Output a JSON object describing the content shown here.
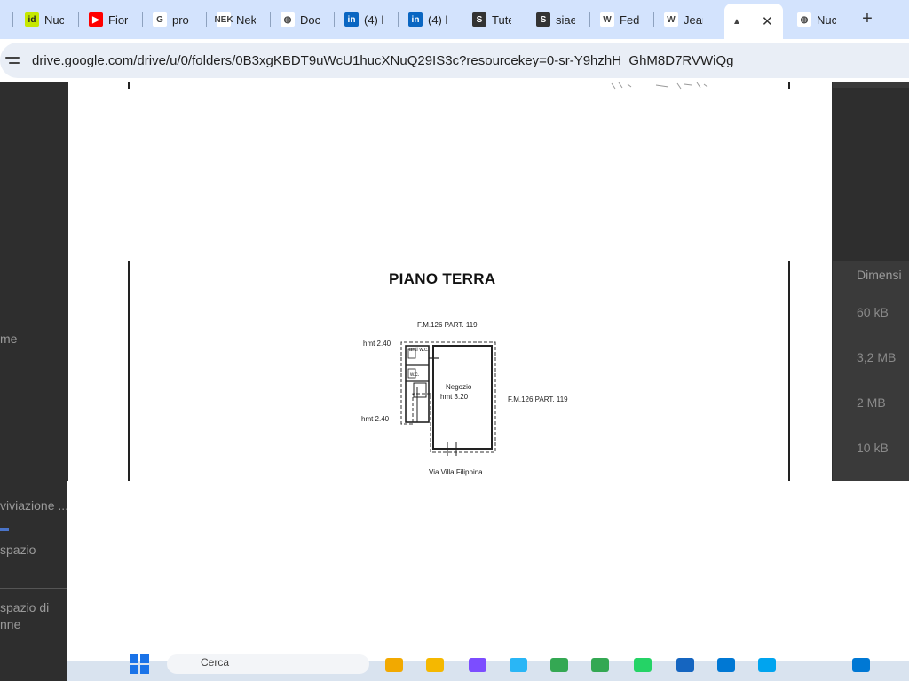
{
  "browser": {
    "tabs": [
      {
        "icon": "id-icon",
        "glyph": "id",
        "color": "#c6e800",
        "label": "Nuc"
      },
      {
        "icon": "youtube-icon",
        "glyph": "▶",
        "color": "#ff0000",
        "label": "Fior"
      },
      {
        "icon": "google-icon",
        "glyph": "G",
        "color": "#ffffff",
        "label": "pro"
      },
      {
        "icon": "nek-icon",
        "glyph": "NEK",
        "color": "#ffffff",
        "label": "Nek"
      },
      {
        "icon": "globe-icon",
        "glyph": "◍",
        "color": "#ffffff",
        "label": "Doc"
      },
      {
        "icon": "linkedin-icon",
        "glyph": "in",
        "color": "#0a66c2",
        "label": "(4) l"
      },
      {
        "icon": "linkedin-icon",
        "glyph": "in",
        "color": "#0a66c2",
        "label": "(4) l"
      },
      {
        "icon": "siae-icon",
        "glyph": "S",
        "color": "#333333",
        "label": "Tute"
      },
      {
        "icon": "siae-icon",
        "glyph": "S",
        "color": "#333333",
        "label": "siae"
      },
      {
        "icon": "wikipedia-icon",
        "glyph": "W",
        "color": "#ffffff",
        "label": "Fed"
      },
      {
        "icon": "wikipedia-icon",
        "glyph": "W",
        "color": "#ffffff",
        "label": "Jear"
      },
      {
        "icon": "google-drive-icon",
        "glyph": "▲",
        "color": "#ffffff",
        "label": ""
      },
      {
        "icon": "globe-icon",
        "glyph": "◍",
        "color": "#ffffff",
        "label": "Nuc"
      }
    ],
    "active_tab_index": 11,
    "close_glyph": "✕",
    "new_tab_glyph": "+",
    "url": "drive.google.com/drive/u/0/folders/0B3xgKBDT9uWcU1hucXNuQ29IS3c?resourcekey=0-sr-Y9hzhH_GhM8D7RVWiQg"
  },
  "drive_background": {
    "sidebar": {
      "item_me": "me",
      "item_archive": "viviazione ...",
      "item_space": "spazio",
      "item_space_of": "spazio di",
      "item_space_of_2": "nne"
    },
    "details_panel": {
      "header": "Dimensi",
      "sizes": [
        "60 kB",
        "3,2 MB",
        "2 MB",
        "10 kB"
      ]
    }
  },
  "document": {
    "title": "PIANO TERRA",
    "labels": {
      "parcel_top": "F.M.126 PART. 119",
      "parcel_right": "F.M.126 PART. 119",
      "height_upper": "hmt 2.40",
      "height_lower": "hmt 2.40",
      "anti_wc": "anti w.c.",
      "wc": "w.c.",
      "shop": "Negozio",
      "shop_height": "hmt 3.20",
      "street": "Via Villa Filippina"
    }
  },
  "taskbar": {
    "search_placeholder": "Cerca"
  }
}
